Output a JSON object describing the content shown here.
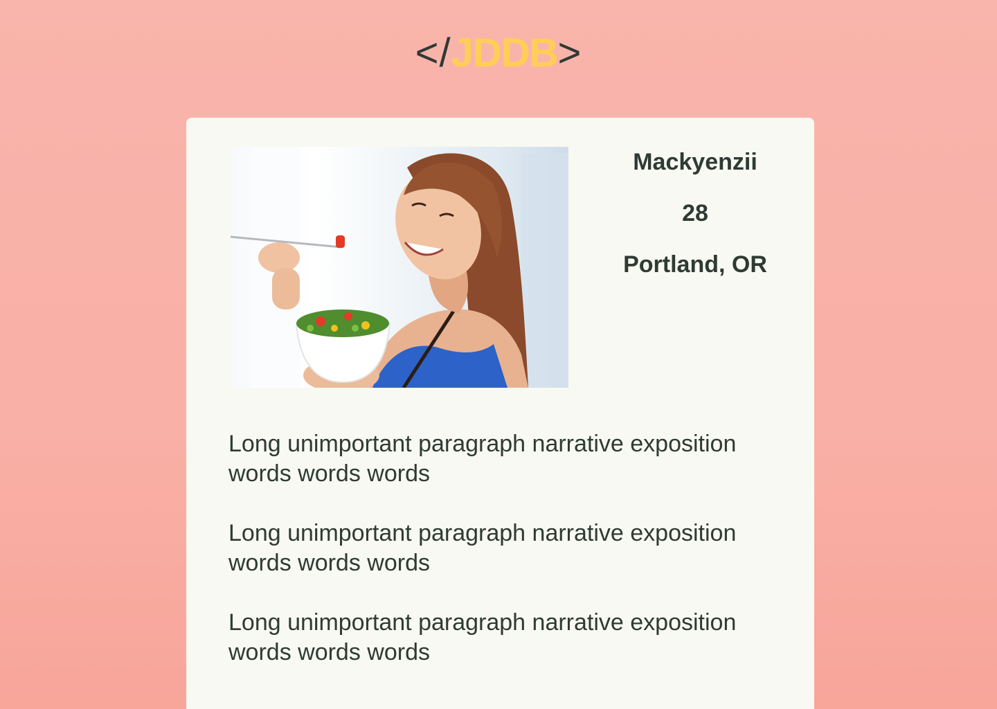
{
  "header": {
    "logo_open": "</",
    "logo_brand": "JDDB",
    "logo_close": ">"
  },
  "profile": {
    "photo_icon": "profile-photo",
    "name": "Mackyenzii",
    "age": "28",
    "location": "Portland, OR"
  },
  "bio": {
    "paragraphs": [
      "Long unimportant paragraph narrative exposition words words words",
      "Long unimportant paragraph narrative exposition words words words",
      "Long unimportant paragraph narrative exposition words words words"
    ]
  },
  "colors": {
    "background": "#f9b4ab",
    "card": "#f8f9f2",
    "text": "#2f3a34",
    "brand_accent": "#ffcf55"
  }
}
